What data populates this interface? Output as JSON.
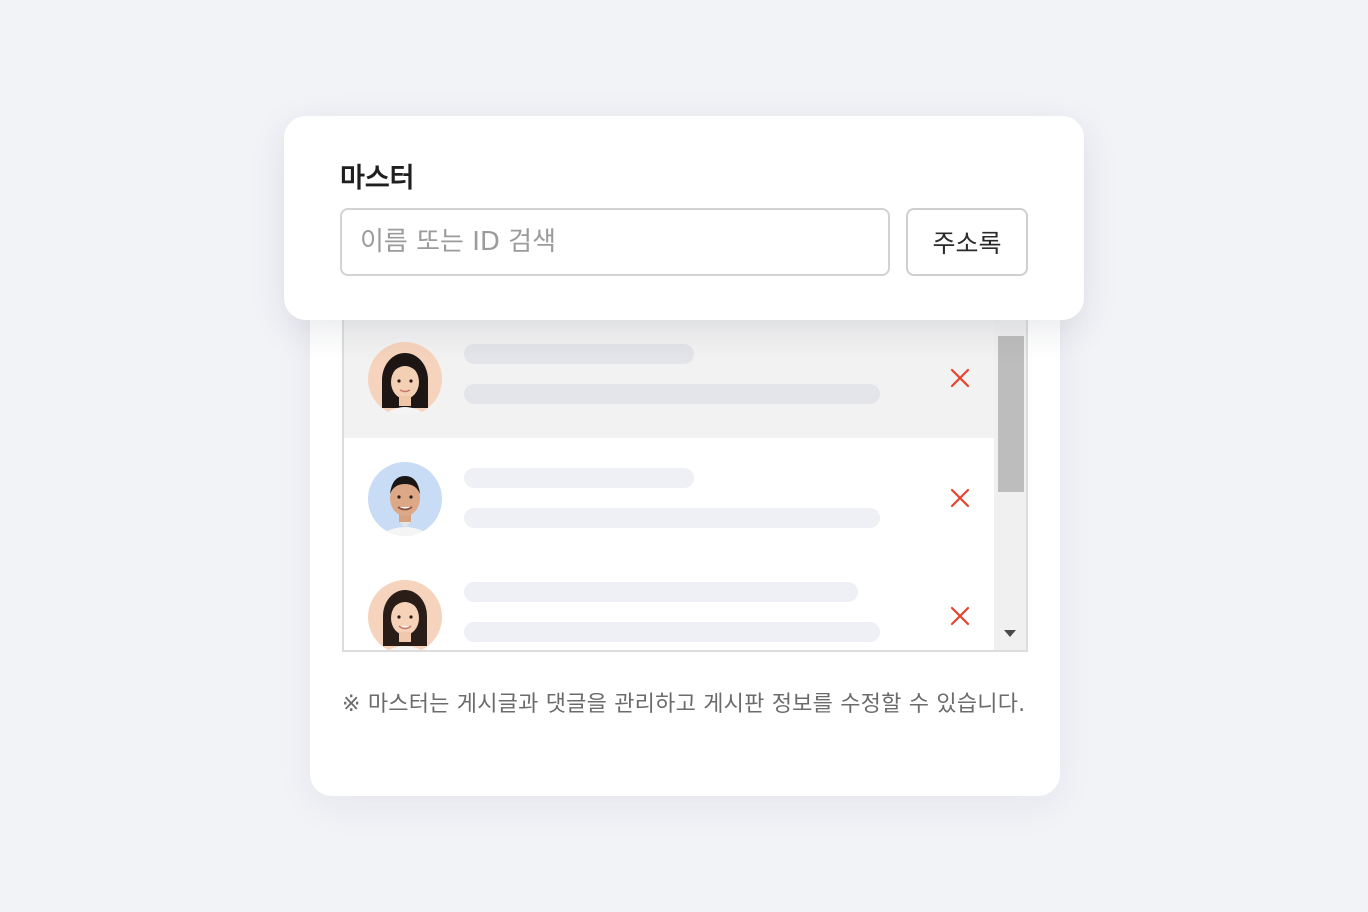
{
  "header": {
    "title": "마스터"
  },
  "search": {
    "placeholder": "이름 또는 ID 검색",
    "value": ""
  },
  "address_book_button": {
    "label": "주소록"
  },
  "members": [
    {
      "avatar": "woman-portrait",
      "avatar_bg": "#f6d3bc",
      "selected": true
    },
    {
      "avatar": "man-portrait",
      "avatar_bg": "#c9dcf5",
      "selected": false
    },
    {
      "avatar": "woman-portrait",
      "avatar_bg": "#f6d3bc",
      "selected": false
    }
  ],
  "icons": {
    "remove": "close-icon",
    "scroll_down": "triangle-down-icon"
  },
  "notice": {
    "text": "※ 마스터는 게시글과 댓글을 관리하고 게시판 정보를 수정할 수 있습니다."
  },
  "colors": {
    "remove_icon": "#e8442e",
    "background": "#f2f3f7",
    "skeleton": "#eef0f5",
    "selected_row": "#f2f2f2"
  }
}
